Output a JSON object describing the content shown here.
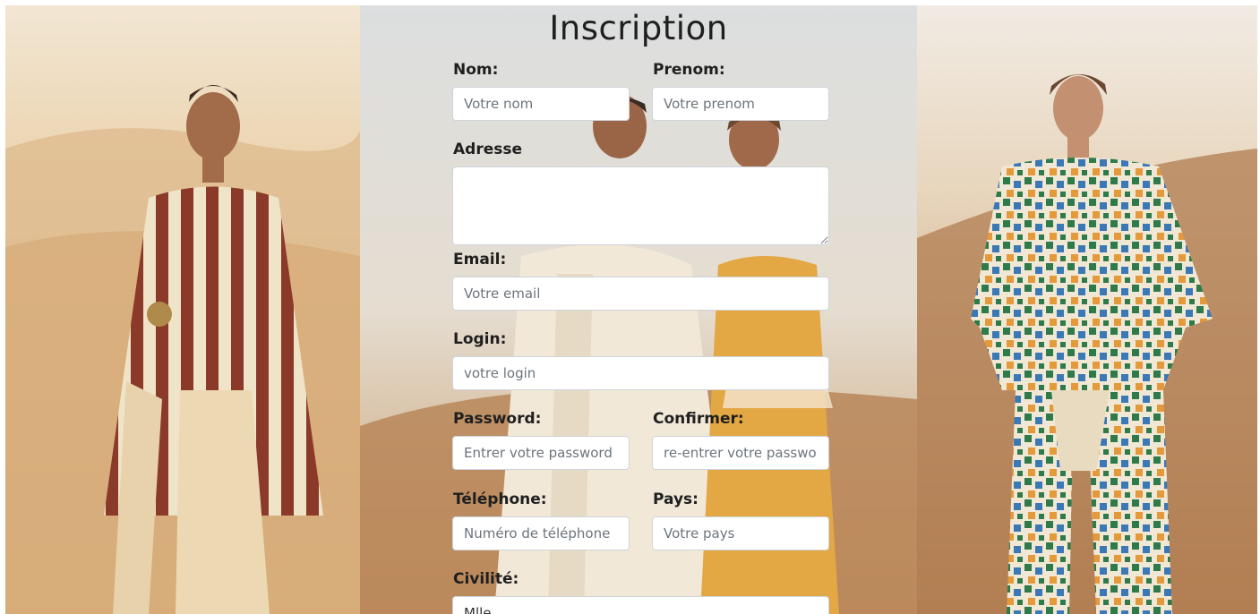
{
  "form": {
    "title": "Inscription",
    "nom": {
      "label": "Nom:",
      "placeholder": "Votre nom"
    },
    "prenom": {
      "label": "Prenom:",
      "placeholder": "Votre prenom"
    },
    "adresse": {
      "label": "Adresse"
    },
    "email": {
      "label": "Email:",
      "placeholder": "Votre email"
    },
    "login": {
      "label": "Login:",
      "placeholder": "votre login"
    },
    "password": {
      "label": "Password:",
      "placeholder": "Entrer votre password"
    },
    "confirmer": {
      "label": "Confirmer:",
      "placeholder": "re-entrer votre passwor"
    },
    "telephone": {
      "label": "Téléphone:",
      "placeholder": "Numéro de téléphone"
    },
    "pays": {
      "label": "Pays:",
      "placeholder": "Votre pays"
    },
    "civilite": {
      "label": "Civilité:",
      "selected": "Mlle"
    }
  },
  "colors": {
    "sand_light": "#e8cfa6",
    "sand_dark": "#c89a66",
    "sky": "#d9dde0",
    "stripe_red": "#8b3a2a",
    "stripe_cream": "#efe3c8"
  }
}
